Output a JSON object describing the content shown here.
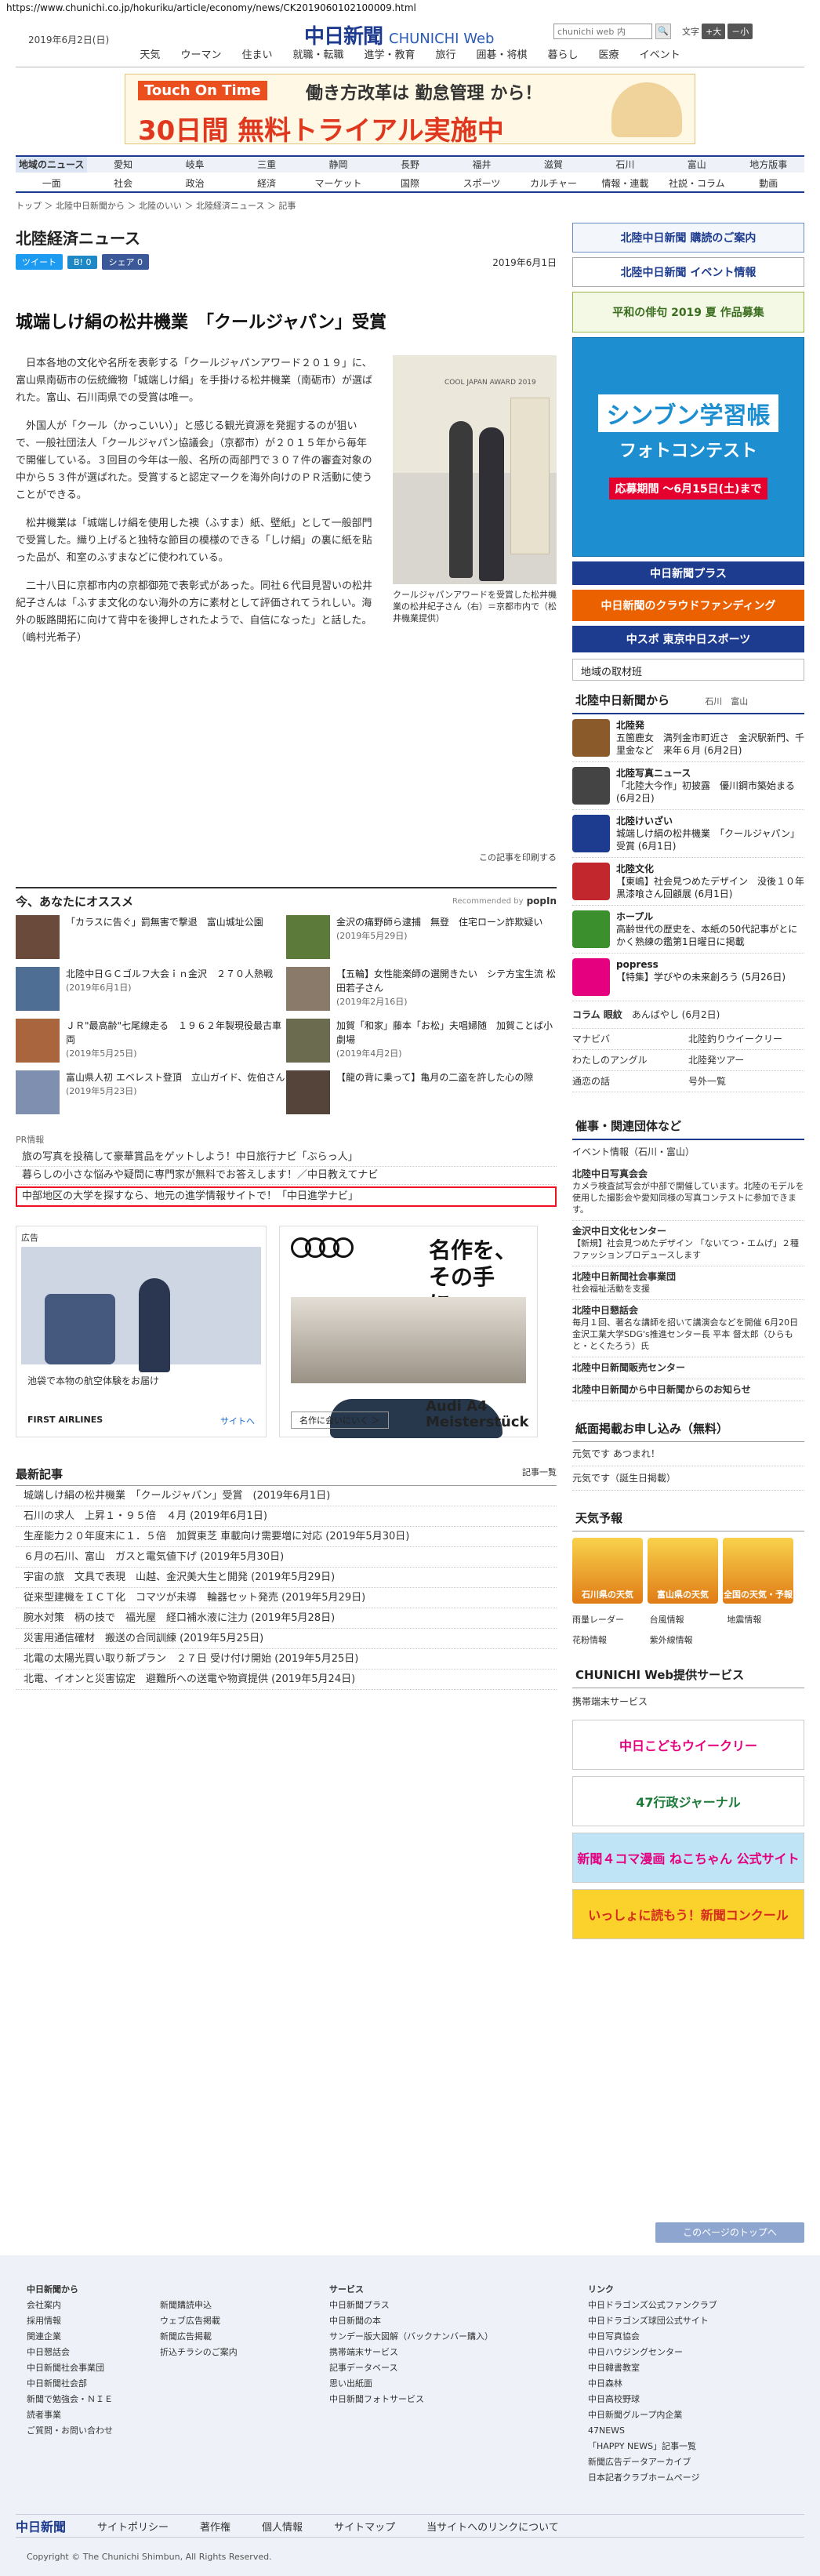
{
  "url": "https://www.chunichi.co.jp/hokuriku/article/economy/news/CK2019060102100009.html",
  "header": {
    "date": "2019年6月2日(日)",
    "logo_jp": "中日新聞",
    "logo_en": "CHUNICHI Web",
    "search_placeholder": "chunichi web 内",
    "search_btn": "🔍",
    "textsize_label": "文字",
    "textsize_small": "小",
    "textsize_large": "+大",
    "textsize_reset": "－小"
  },
  "topnav": [
    "天気",
    "ウーマン",
    "住まい",
    "就職・転職",
    "進学・教育",
    "旅行",
    "囲碁・将棋",
    "暮らし",
    "医療",
    "イベント"
  ],
  "top_ad": {
    "l1": "Touch On Time",
    "l2": "働き方改革は 勤怠管理 から！",
    "l3": "30日間 無料トライアル実施中"
  },
  "regnav": [
    "地域のニュース",
    "愛知",
    "岐阜",
    "三重",
    "静岡",
    "長野",
    "福井",
    "滋賀",
    "石川",
    "富山",
    "地方版事"
  ],
  "regnav_active": "地域のニュース",
  "catnav": [
    "一面",
    "社会",
    "政治",
    "経済",
    "マーケット",
    "国際",
    "スポーツ",
    "カルチャー",
    "情報・連載",
    "社説・コラム",
    "動画"
  ],
  "breadcrumb": "トップ ＞ 北陸中日新聞から ＞ 北陸のいい ＞ 北陸経済ニュース ＞ 記事",
  "section_title": "北陸経済ニュース",
  "share": {
    "tweet": "ツイート",
    "hatena": "B! 0",
    "facebook": "シェア 0"
  },
  "article": {
    "date": "2019年6月1日",
    "headline": "城端しけ絹の松井機業　「クールジャパン」受賞",
    "paragraphs": [
      "日本各地の文化や名所を表彰する「クールジャパンアワード２０１９」に、富山県南砺市の伝統織物「城端しけ絹」を手掛ける松井機業（南砺市）が選ばれた。富山、石川両県での受賞は唯一。",
      "外国人が「クール（かっこいい）」と感じる観光資源を発掘するのが狙いで、一般社団法人「クールジャパン協議会」（京都市）が２０１５年から毎年で開催している。３回目の今年は一般、名所の両部門で３０７件の審査対象の中から５３件が選ばれた。受賞すると認定マークを海外向けのＰＲ活動に使うことができる。",
      "松井機業は「城端しけ絹を使用した襖（ふすま）紙、壁紙」として一般部門で受賞した。織り上げると独特な節目の模様のできる「しけ絹」の裏に紙を貼った品が、和室のふすまなどに使われている。",
      "二十八日に京都市内の京都御苑で表彰式があった。同社６代目見習いの松井紀子さんは「ふすま文化のない海外の方に素材として評価されてうれしい。海外の販路開拓に向けて背中を後押しされたようで、自信になった」と話した。　（嶋村光希子）"
    ],
    "photo_caption": "クールジャパンアワードを受賞した松井機業の松井紀子さん（右）＝京都市内で（松井機業提供）",
    "photo_label": "COOL JAPAN AWARD 2019",
    "print_label": "この記事を印刷する"
  },
  "recommend": {
    "title": "今、あなたにオススメ",
    "recommended_by": "Recommended by",
    "provider": "popIn",
    "items": [
      {
        "text": "「カラスに告ぐ」罰無害で撃退　富山城址公園",
        "date": ""
      },
      {
        "text": "金沢の痛野師ら逮捕　無登　住宅ローン詐欺疑い",
        "date": "(2019年5月29日)"
      },
      {
        "text": "北陸中日ＧＣゴルフ大会ｉｎ金沢　２７０人熱戦",
        "date": "(2019年6月1日)"
      },
      {
        "text": "【五輪】女性能楽師の選開きたい　シテ方宝生流 松田若子さん",
        "date": "(2019年2月16日)"
      },
      {
        "text": "ＪＲ\"最高齢\"七尾線走る　１９６２年製現役最古車両",
        "date": "(2019年5月25日)"
      },
      {
        "text": "加賀「和家」藤本「お松」夫唱婦随　加賀ことば小劇場",
        "date": "(2019年4月2日)"
      },
      {
        "text": "富山県人初 エベレスト登頂　立山ガイド、佐伯さん",
        "date": "(2019年5月23日)"
      },
      {
        "text": "【龍の背に乗って】亀月の二盗を許した心の隙",
        "date": ""
      }
    ]
  },
  "pr": {
    "label": "PR情報",
    "items": [
      "旅の写真を投稿して豪華賞品をゲットしよう！中日旅行ナビ「ぶらっ人」",
      "暮らしの小さな悩みや疑問に専門家が無料でお答えします！／中日教えてナビ",
      "中部地区の大学を探すなら、地元の進学情報サイトで！「中日進学ナビ」"
    ]
  },
  "ad_air": {
    "label": "広告",
    "caption": "池袋で本物の航空体験をお届け",
    "brand": "FIRST AIRLINES",
    "site": "サイトへ"
  },
  "ad_audi": {
    "copy": "名作を、その手に。",
    "btn": "名作に会いにいく ＞",
    "model": "Audi A4 Meisterstück"
  },
  "latest": {
    "title": "最新記事",
    "more": "記事一覧",
    "items": [
      "城端しけ絹の松井機業　「クールジャパン」受賞　(2019年6月1日)",
      "石川の求人　上昇１・９５倍　４月 (2019年6月1日)",
      "生産能力２０年度末に１．５倍　加賀東芝 車載向け需要増に対応 (2019年5月30日)",
      "６月の石川、富山　ガスと電気値下げ (2019年5月30日)",
      "宇宙の旅　文具で表現　山越、金沢美大生と開発 (2019年5月29日)",
      "従来型建機をＩＣＴ化　コマツが未導　輪器セット発売 (2019年5月29日)",
      "腕水対策　柄の技で　福光屋　経口補水液に注力 (2019年5月28日)",
      "災害用通信確材　搬送の合同訓練 (2019年5月25日)",
      "北電の太陽光買い取り新プラン　２７日 受け付け開始 (2019年5月25日)",
      "北電、イオンと災害協定　避難所への送電や物資提供 (2019年5月24日)"
    ]
  },
  "side": {
    "b1": "北陸中日新聞 購読のご案内",
    "b2": "北陸中日新聞 イベント情報",
    "b3": "平和の俳句 2019 夏 作品募集",
    "b4_big": "シンブン学習帳",
    "b4_sub": "フォトコンテスト",
    "b4_dl": "応募期間 ～6月15日(土)まで",
    "b5": "中日新聞プラス",
    "b6": "中日新聞のクラウドファンディング",
    "b7": "中スポ 東京中日スポーツ",
    "local_btn": "地域の取材班",
    "from_title": "北陸中日新聞から",
    "from_links": "石川　富山",
    "from_items": [
      {
        "t": "北陸発",
        "d": "五箇鹿女　満列金市町近さ　金沢駅新門、千里金など　来年６月 (6月2日)",
        "c": "#8b5a2b"
      },
      {
        "t": "北陸写真ニュース",
        "d": "「北陸大今作」初披露　優川鋼市築始まる (6月2日)",
        "c": "#444"
      },
      {
        "t": "北陸けいざい",
        "d": "城端しけ絹の松井機業　「クールジャパン」受賞 (6月1日)",
        "c": "#1d3b8f"
      },
      {
        "t": "北陸文化",
        "d": "【東嶋】社会見つめたデザイン　没後１０年 黒漆喰さん回顧展 (6月1日)",
        "c": "#c1272d"
      },
      {
        "t": "ホープル",
        "d": "高齢世代の歴史を、本紙の50代記事がとにかく熟練の鑑第1日曜日に掲載",
        "c": "#3b8f2c"
      },
      {
        "t": "popress",
        "d": "【特集】学びやの未来創ろう (5月26日)",
        "c": "#e4007f"
      }
    ],
    "column_label": "コラム 眼紋",
    "column_date": "あんばやし (6月2日)",
    "grid_links": [
      "マナビバ",
      "北陸釣りウイークリー",
      "わたしのアングル",
      "北陸発ツアー",
      "通恋の話",
      "号外一覧"
    ],
    "events_title": "催事・関連団体など",
    "events_sub": "イベント情報（石川・富山）",
    "events": [
      {
        "t": "北陸中日写真会会",
        "d": "カメラ検査試写会が中部で開催しています。北陸のモデルを使用した撮影会や愛知同様の写真コンテストに参加できます。"
      },
      {
        "t": "金沢中日文化センター",
        "d": "【新規】社会見つめたデザイン 「ないてつ・エムげ」２種ファッションプロデュースします"
      },
      {
        "t": "北陸中日新聞社会事業団",
        "d": "社会福祉活動を支援"
      },
      {
        "t": "北陸中日懇話会",
        "d": "毎月１回、著名な講師を招いて講演会などを開催 6月20日 金沢工業大学SDG's推進センター長 平本 督太郎（ひらもと・とくたろう）氏"
      },
      {
        "t": "北陸中日新聞販売センター",
        "d": ""
      },
      {
        "t": "北陸中日新聞から中日新聞からのお知らせ",
        "d": ""
      }
    ],
    "paper_title": "紙面掲載お申し込み（無料）",
    "paper_items": [
      "元気です あつまれ！",
      "元気です（誕生日掲載）"
    ],
    "weather_title": "天気予報",
    "weather": [
      "石川県の天気",
      "富山県の天気",
      "全国の天気・予報"
    ],
    "weather_links": [
      "雨量レーダー",
      "台風情報",
      "地震情報",
      "花粉情報",
      "紫外線情報"
    ],
    "services_title": "CHUNICHI Web提供サービス",
    "services_item": "携帯端末サービス",
    "sb1": "中日こどもウイークリー",
    "sb2": "47行政ジャーナル",
    "sb3": "新聞４コマ漫画 ねこちゃん 公式サイト",
    "sb4": "いっしょに読もう！新聞コンクール"
  },
  "to_top": "このページのトップへ",
  "footer": {
    "col1_title": "中日新聞から",
    "col1": [
      "会社案内",
      "採用情報",
      "関連企業",
      "中日懇話会",
      "中日新聞社会事業団",
      "中日新聞社会部",
      "新聞で勉強会・ＮＩＥ",
      "読者事業",
      "ご質問・お問い合わせ"
    ],
    "col2": [
      "新聞購読申込",
      "ウェブ広告掲載",
      "新聞広告掲載",
      "折込チラシのご案内"
    ],
    "col3_title": "サービス",
    "col3": [
      "中日新聞プラス",
      "中日新聞の本",
      "サンデー版大図解（バックナンバー購入）",
      "携帯端末サービス",
      "記事データベース",
      "思い出紙面",
      "中日新聞フォトサービス"
    ],
    "col4_title": "リンク",
    "col4": [
      "中日ドラゴンズ公式ファンクラブ",
      "中日ドラゴンズ球団公式サイト",
      "中日写真協会",
      "中日ハウジングセンター",
      "中日韓書教室",
      "中日森林",
      "中日高校野球",
      "中日新聞グループ内企業",
      "47NEWS",
      "「HAPPY NEWS」記事一覧",
      "新聞広告データアーカイブ",
      "日本記者クラブホームページ"
    ],
    "bar_logo": "中日新聞",
    "bar_links": [
      "サイトポリシー",
      "著作権",
      "個人情報",
      "サイトマップ",
      "当サイトへのリンクについて"
    ],
    "copyright": "Copyright © The Chunichi Shimbun, All Rights Reserved."
  }
}
